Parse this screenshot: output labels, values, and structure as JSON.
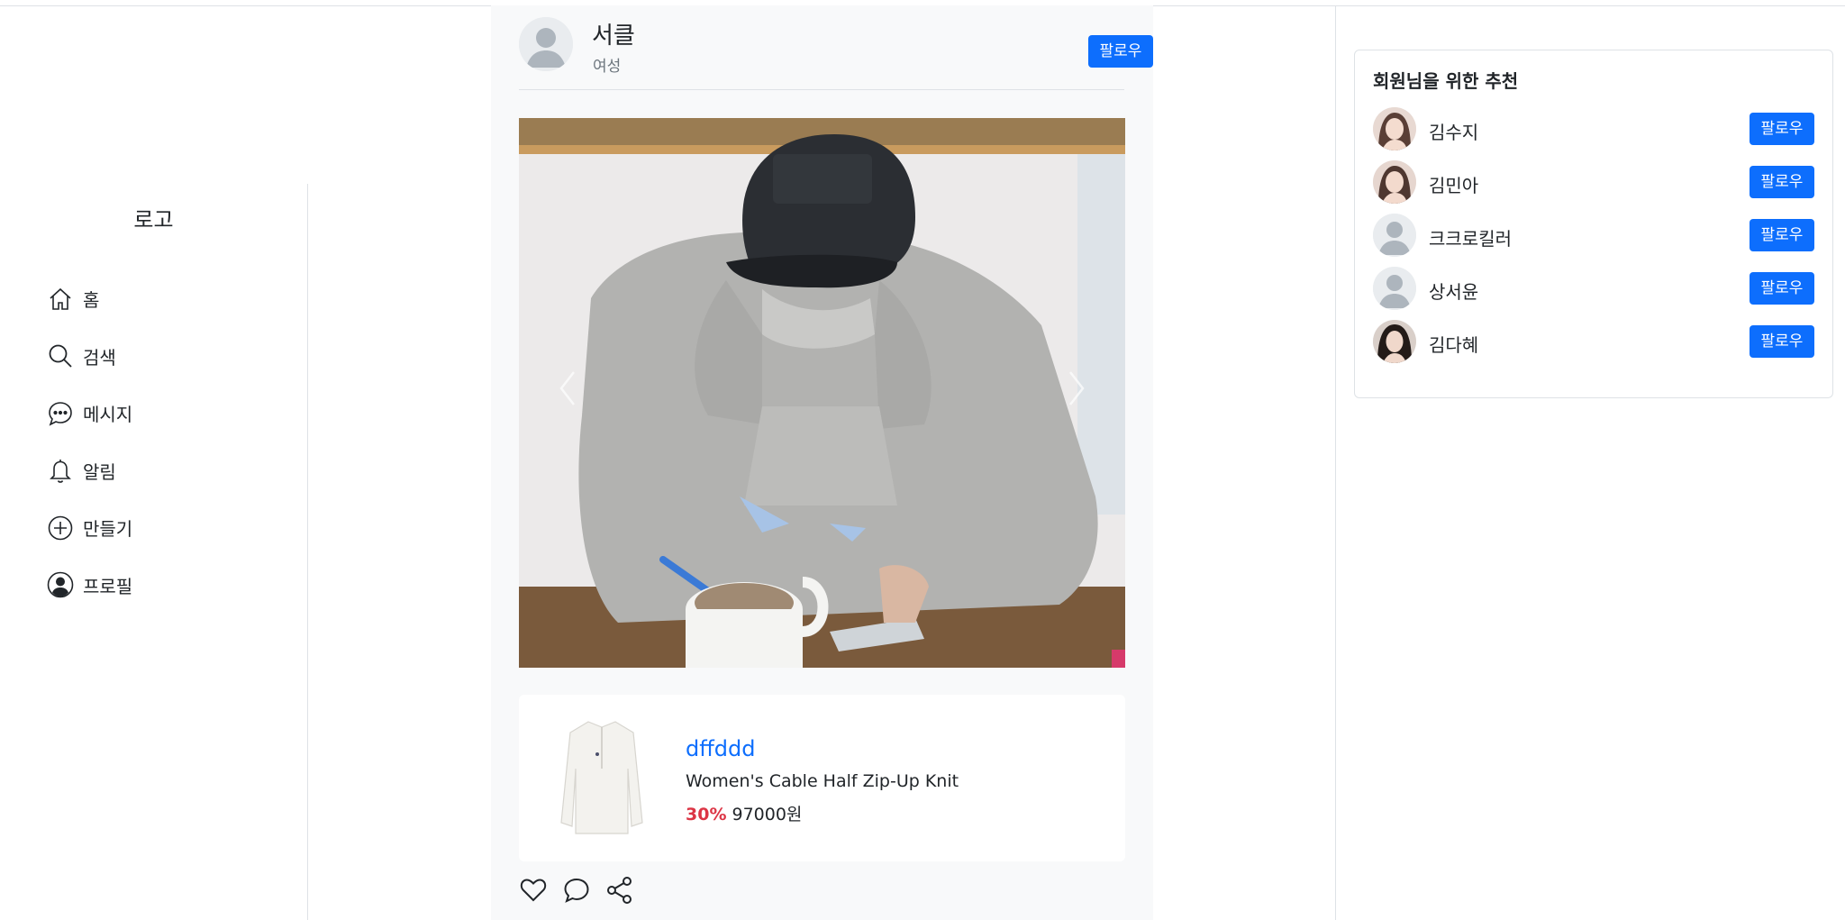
{
  "sidebar": {
    "logo": "로고",
    "items": [
      {
        "label": "홈",
        "icon": "home-icon"
      },
      {
        "label": "검색",
        "icon": "search-icon"
      },
      {
        "label": "메시지",
        "icon": "message-icon"
      },
      {
        "label": "알림",
        "icon": "bell-icon"
      },
      {
        "label": "만들기",
        "icon": "plus-circle-icon"
      },
      {
        "label": "프로필",
        "icon": "profile-icon"
      }
    ]
  },
  "post": {
    "author": {
      "name": "서클",
      "subtitle": "여성"
    },
    "follow_label": "팔로우",
    "product": {
      "brand": "dffddd",
      "name": "Women's Cable Half Zip-Up Knit",
      "discount": "30%",
      "price": "97000원"
    }
  },
  "recommendations": {
    "title": "회원님을 위한 추천",
    "follow_label": "팔로우",
    "users": [
      {
        "name": "김수지",
        "avatar": "photo"
      },
      {
        "name": "김민아",
        "avatar": "photo"
      },
      {
        "name": "크크로킬러",
        "avatar": "default"
      },
      {
        "name": "상서윤",
        "avatar": "default"
      },
      {
        "name": "김다혜",
        "avatar": "photo"
      }
    ]
  },
  "colors": {
    "accent": "#0d6efd",
    "discount": "#dc3545",
    "feed_bg": "#f8f9fa",
    "border": "#dee2e6"
  }
}
